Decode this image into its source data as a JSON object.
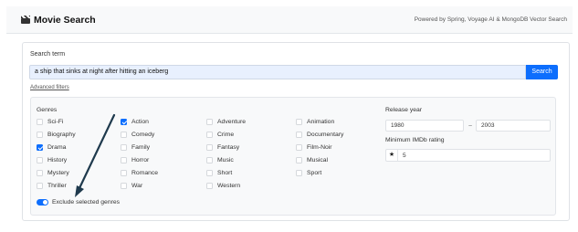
{
  "header": {
    "app_icon": "clapperboard-icon",
    "title": "Movie Search",
    "powered_by": "Powered by Spring, Voyage AI & MongoDB Vector Search"
  },
  "search": {
    "label": "Search term",
    "value": "a ship that sinks at night after hitting an iceberg",
    "button_label": "Search",
    "advanced_link": "Advanced filters"
  },
  "filters": {
    "genres_title": "Genres",
    "genres": [
      {
        "label": "Sci-Fi",
        "checked": false
      },
      {
        "label": "Biography",
        "checked": false
      },
      {
        "label": "Drama",
        "checked": true
      },
      {
        "label": "History",
        "checked": false
      },
      {
        "label": "Mystery",
        "checked": false
      },
      {
        "label": "Thriller",
        "checked": false
      },
      {
        "label": "Action",
        "checked": true
      },
      {
        "label": "Comedy",
        "checked": false
      },
      {
        "label": "Family",
        "checked": false
      },
      {
        "label": "Horror",
        "checked": false
      },
      {
        "label": "Romance",
        "checked": false
      },
      {
        "label": "War",
        "checked": false
      },
      {
        "label": "Adventure",
        "checked": false
      },
      {
        "label": "Crime",
        "checked": false
      },
      {
        "label": "Fantasy",
        "checked": false
      },
      {
        "label": "Music",
        "checked": false
      },
      {
        "label": "Short",
        "checked": false
      },
      {
        "label": "Western",
        "checked": false
      },
      {
        "label": "Animation",
        "checked": false
      },
      {
        "label": "Documentary",
        "checked": false
      },
      {
        "label": "Film-Noir",
        "checked": false
      },
      {
        "label": "Musical",
        "checked": false
      },
      {
        "label": "Sport",
        "checked": false
      }
    ],
    "exclude_label": "Exclude selected genres",
    "exclude_on": true,
    "release_year_label": "Release year",
    "year_from": "1980",
    "year_separator": "–",
    "year_to": "2003",
    "imdb_label": "Minimum IMDb rating",
    "imdb_icon": "star-icon",
    "imdb_value": "5"
  },
  "annotation": {
    "arrow_color": "#1f3a4d"
  },
  "colors": {
    "accent": "#0d6efd"
  }
}
